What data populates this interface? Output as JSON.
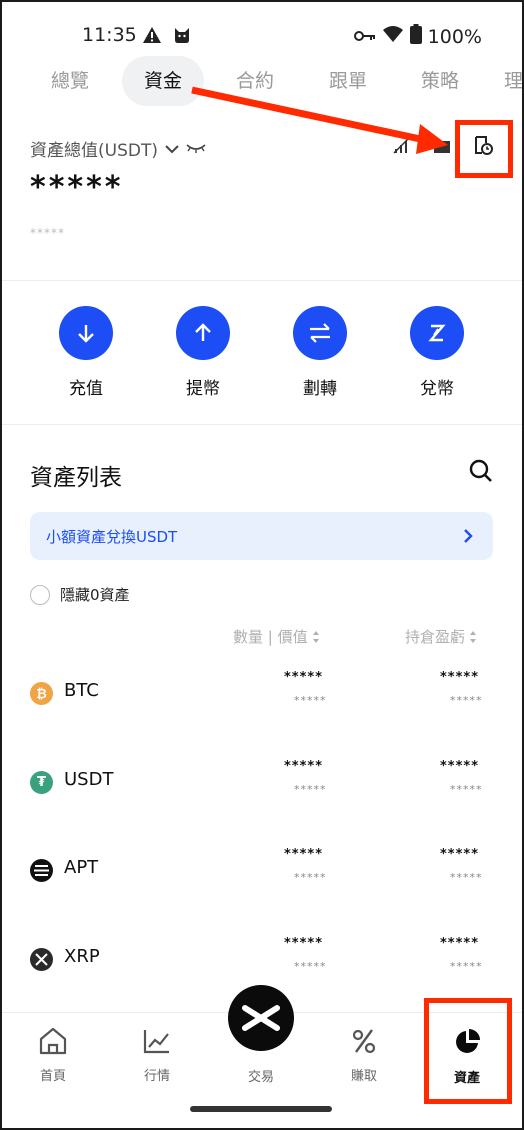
{
  "status_bar": {
    "time": "11:35",
    "battery": "100%"
  },
  "tabs": [
    {
      "label": "總覽"
    },
    {
      "label": "資金"
    },
    {
      "label": "合約"
    },
    {
      "label": "跟單"
    },
    {
      "label": "策略"
    },
    {
      "label": "理"
    }
  ],
  "header": {
    "assets_label": "資產總值(USDT)",
    "total_hidden": "*****",
    "sub_hidden": "*****"
  },
  "actions": [
    {
      "label": "充值",
      "icon": "arrow-down-icon"
    },
    {
      "label": "提幣",
      "icon": "arrow-up-icon"
    },
    {
      "label": "劃轉",
      "icon": "transfer-icon"
    },
    {
      "label": "兌幣",
      "icon": "convert-icon"
    }
  ],
  "asset_list": {
    "title": "資產列表",
    "banner": "小額資產兌換USDT",
    "hide_zero_label": "隱藏0資產",
    "col_qty": "數量 | 價值",
    "col_pnl": "持倉盈虧",
    "rows": [
      {
        "name": "BTC",
        "color": "#f0a445",
        "qty_top": "*****",
        "qty_bot": "*****",
        "pnl_top": "*****",
        "pnl_bot": "*****"
      },
      {
        "name": "USDT",
        "color": "#3aa17f",
        "qty_top": "*****",
        "qty_bot": "*****",
        "pnl_top": "*****",
        "pnl_bot": "*****"
      },
      {
        "name": "APT",
        "color": "#111111",
        "qty_top": "*****",
        "qty_bot": "*****",
        "pnl_top": "*****",
        "pnl_bot": "*****"
      },
      {
        "name": "XRP",
        "color": "#2a2a2a",
        "qty_top": "*****",
        "qty_bot": "*****",
        "pnl_top": "*****",
        "pnl_bot": "*****"
      }
    ]
  },
  "bottom_nav": {
    "home": "首頁",
    "market": "行情",
    "trade": "交易",
    "earn": "賺取",
    "assets": "資產"
  },
  "colors": {
    "accent": "#1c4df5",
    "highlight": "#ff2a00"
  }
}
